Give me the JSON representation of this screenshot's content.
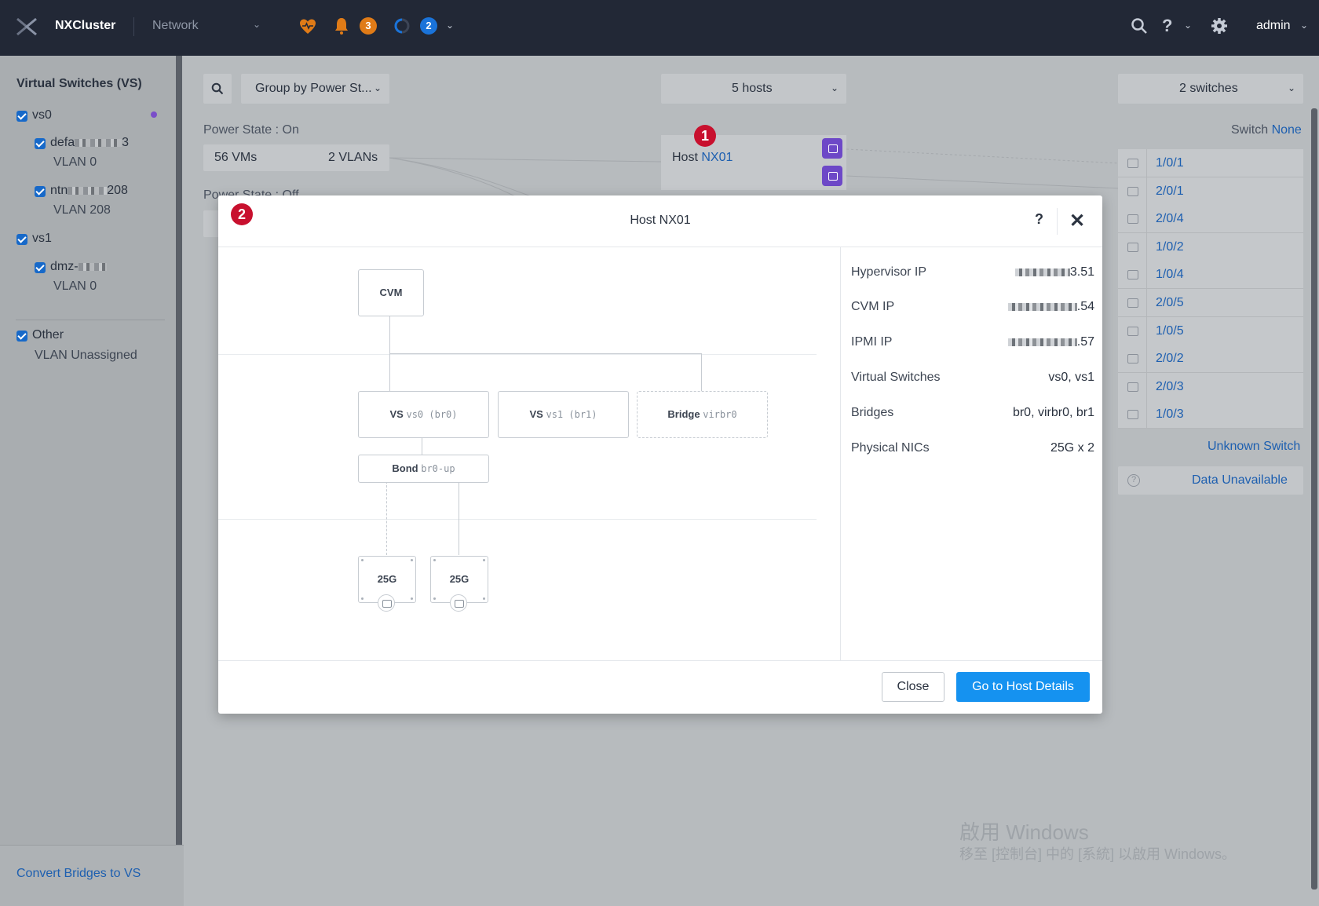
{
  "topbar": {
    "cluster_name": "NXCluster",
    "section": "Network",
    "alerts_count": "3",
    "tasks_count": "2",
    "user": "admin",
    "help_label": "?"
  },
  "sidebar": {
    "title": "Virtual Switches (VS)",
    "vs0": "vs0",
    "net1_prefix": "defa",
    "net1_suffix": "3",
    "net1_vlan": "VLAN 0",
    "net2_prefix": "ntn",
    "net2_suffix": "208",
    "net2_vlan": "VLAN 208",
    "vs1": "vs1",
    "net3_prefix": "dmz-",
    "net3_vlan": "VLAN 0",
    "other": "Other",
    "other_vlan": "VLAN Unassigned",
    "footer_link": "Convert Bridges to VS"
  },
  "toolbar": {
    "group_by": "Group by Power St...",
    "hosts": "5 hosts",
    "switches": "2 switches"
  },
  "main": {
    "power_on_label": "Power State : On",
    "vms": "56 VMs",
    "vlans": "2 VLANs",
    "power_off_label": "Power State : Off",
    "host_prefix": "Host",
    "host_name": "NX01",
    "switch_label": "Switch",
    "switch_value": "None",
    "ports": [
      "1/0/1",
      "2/0/1",
      "2/0/4",
      "1/0/2",
      "1/0/4",
      "2/0/5",
      "1/0/5",
      "2/0/2",
      "2/0/3",
      "1/0/3"
    ],
    "unknown_switch": "Unknown Switch",
    "data_unavailable": "Data Unavailable",
    "marker1": "1",
    "marker2": "2"
  },
  "modal": {
    "title": "Host NX01",
    "help": "?",
    "diagram": {
      "cvm": "CVM",
      "vs0_label": "VS",
      "vs0_name": "vs0 (br0)",
      "vs1_label": "VS",
      "vs1_name": "vs1 (br1)",
      "bridge_label": "Bridge",
      "bridge_name": "virbr0",
      "bond_label": "Bond",
      "bond_name": "br0-up",
      "nic1": "25G",
      "nic2": "25G"
    },
    "info": {
      "hypervisor_ip_label": "Hypervisor IP",
      "hypervisor_ip_suffix": "3.51",
      "cvm_ip_label": "CVM IP",
      "cvm_ip_suffix": ".54",
      "ipmi_ip_label": "IPMI IP",
      "ipmi_ip_suffix": ".57",
      "vs_label": "Virtual Switches",
      "vs_value": "vs0, vs1",
      "bridges_label": "Bridges",
      "bridges_value": "br0, virbr0, br1",
      "nics_label": "Physical NICs",
      "nics_value": "25G x 2"
    },
    "close_label": "Close",
    "go_label": "Go to Host Details"
  },
  "watermark": {
    "line1": "啟用 Windows",
    "line2": "移至 [控制台] 中的 [系統] 以啟用 Windows。"
  },
  "colors": {
    "topbar_bg": "#222836",
    "accent_blue": "#1592f0",
    "link_blue": "#1d5fb0",
    "purple": "#6d48c7",
    "marker_red": "#c8102e"
  }
}
